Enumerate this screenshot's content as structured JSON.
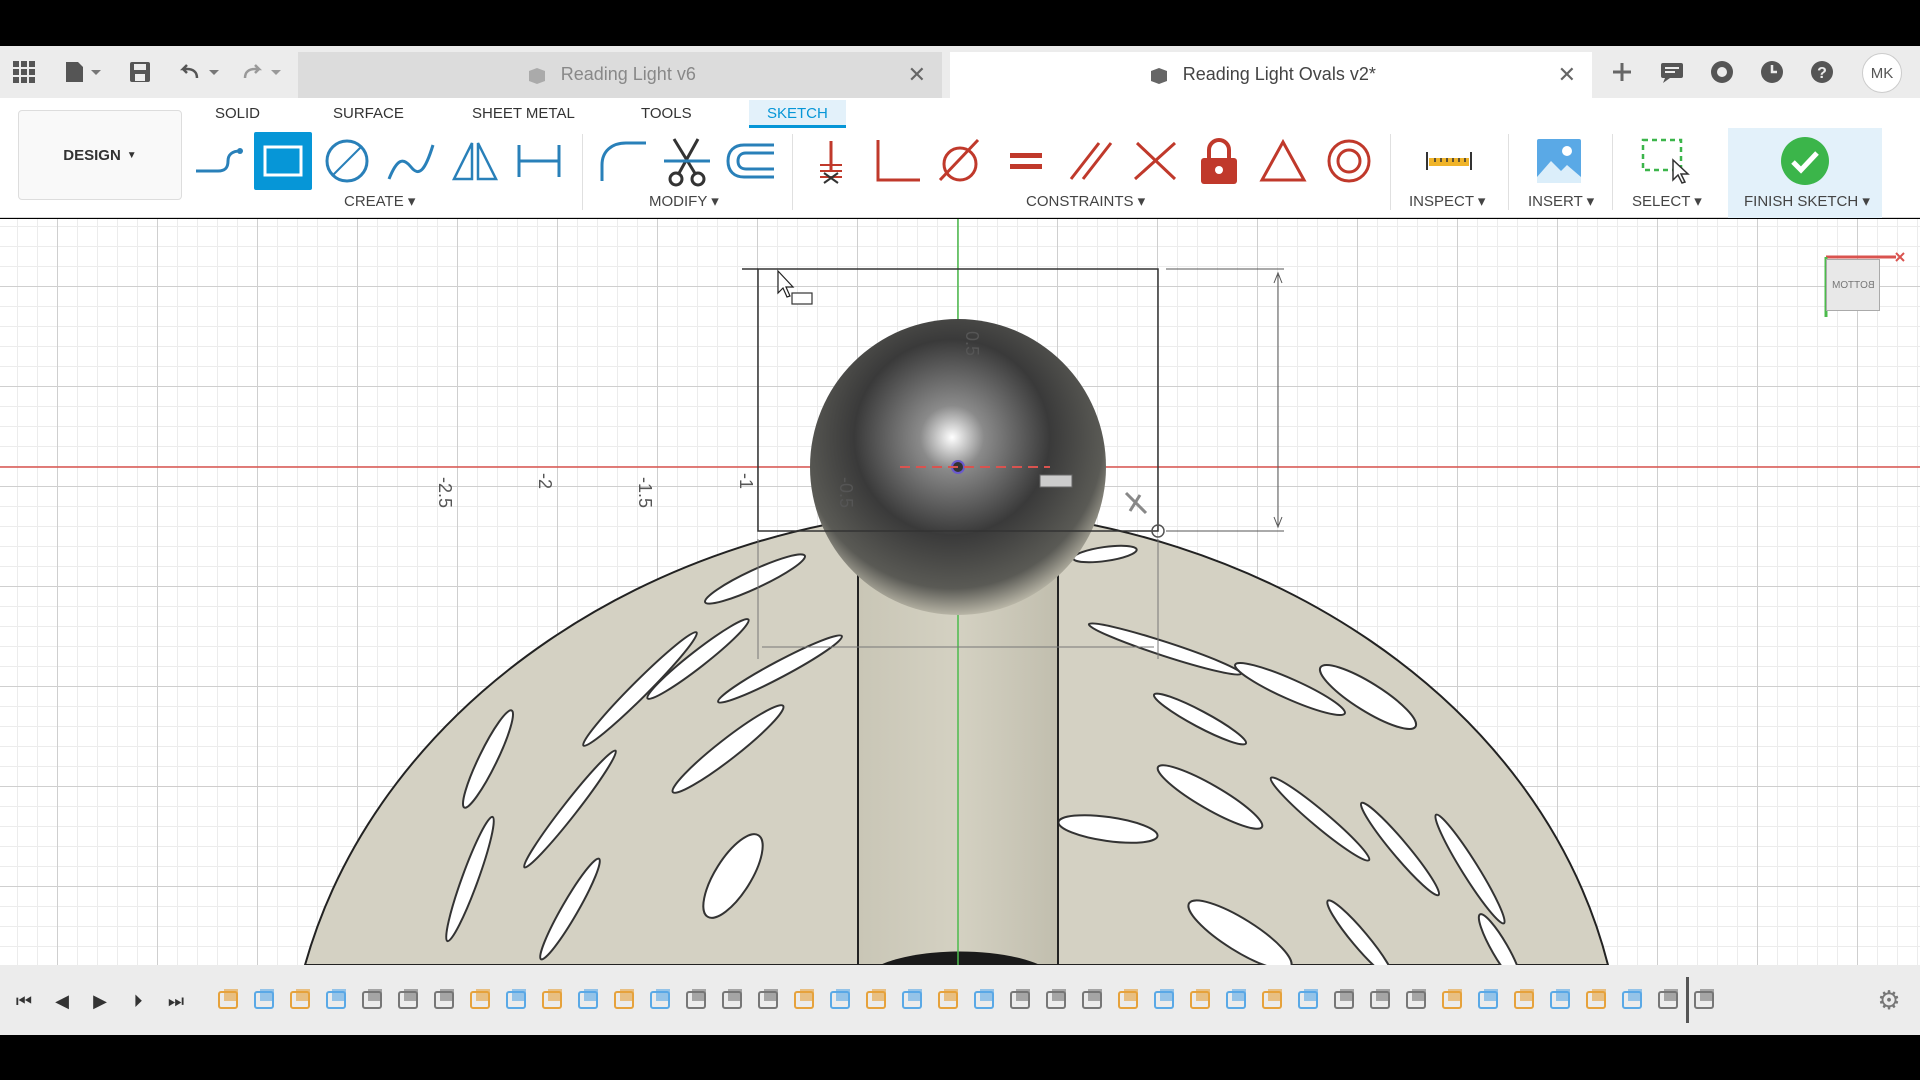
{
  "topbar": {
    "tabs": [
      {
        "title": "Reading Light v6",
        "active": false
      },
      {
        "title": "Reading Light Ovals v2*",
        "active": true
      }
    ],
    "user_initials": "MK"
  },
  "ribbon": {
    "workspace": "DESIGN",
    "tabs": [
      {
        "label": "SOLID"
      },
      {
        "label": "SURFACE"
      },
      {
        "label": "SHEET METAL"
      },
      {
        "label": "TOOLS"
      },
      {
        "label": "SKETCH"
      }
    ],
    "active_tab": "SKETCH",
    "groups": {
      "create": "CREATE",
      "modify": "MODIFY",
      "constraints": "CONSTRAINTS",
      "inspect": "INSPECT",
      "insert": "INSERT",
      "select": "SELECT",
      "finish": "FINISH SKETCH"
    }
  },
  "canvas": {
    "axis_labels": [
      "-2.5",
      "-2",
      "-1.5",
      "-1",
      "-0.5",
      "0.5"
    ],
    "viewcube": "BOTTOM"
  },
  "colors": {
    "accent": "#0696d7",
    "finish_check": "#3bb54a",
    "x_axis": "#d9534f",
    "y_axis": "#4cbb4c"
  }
}
